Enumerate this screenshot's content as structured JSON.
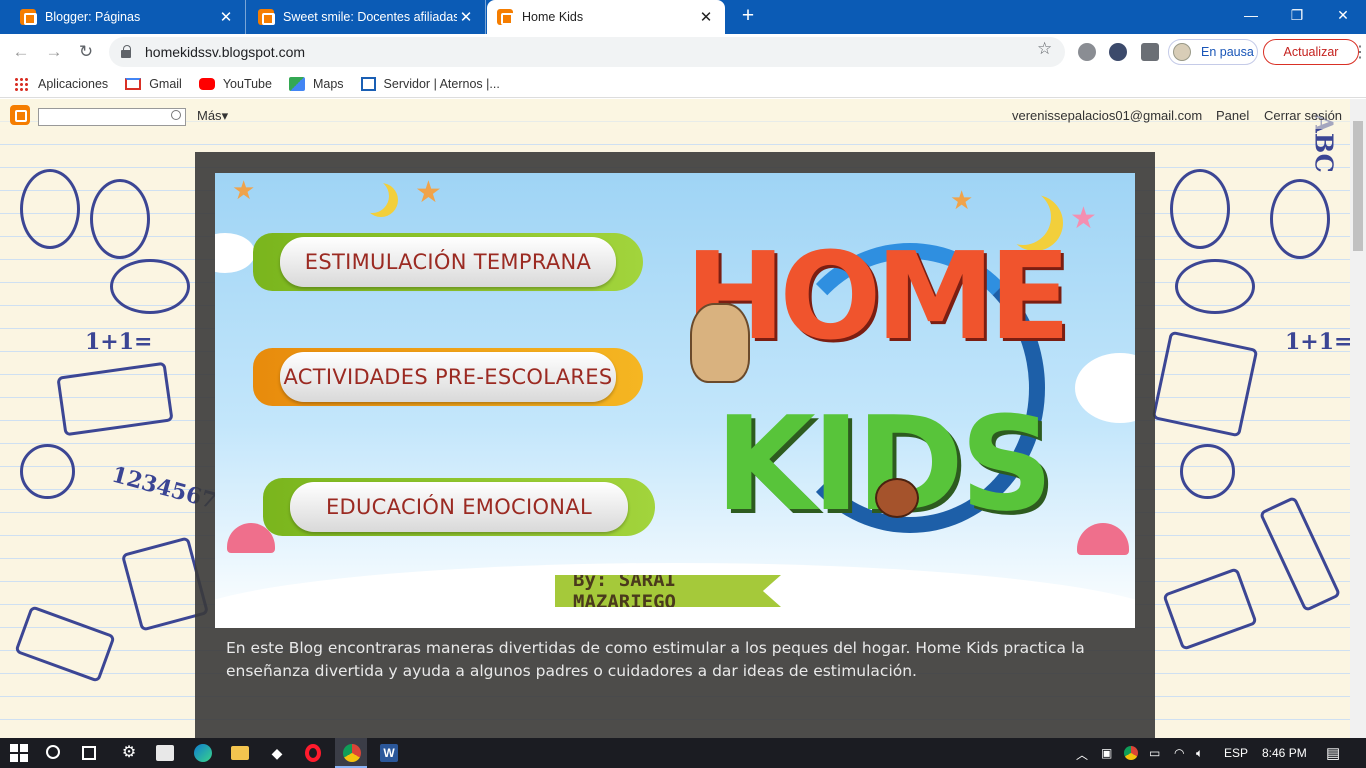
{
  "browser": {
    "tabs": [
      {
        "title": "Blogger: Páginas",
        "active": false
      },
      {
        "title": "Sweet smile: Docentes afiliadas",
        "active": false
      },
      {
        "title": "Home Kids",
        "active": true
      }
    ],
    "url": "homekidssv.blogspot.com",
    "profile_label": "En pausa",
    "update_label": "Actualizar",
    "bookmarks": [
      "Aplicaciones",
      "Gmail",
      "YouTube",
      "Maps",
      "Servidor | Aternos |..."
    ]
  },
  "blogger_navbar": {
    "more_label": "Más",
    "email": "verenissepalacios01@gmail.com",
    "panel_label": "Panel",
    "logout_label": "Cerrar sesión"
  },
  "banner": {
    "buttons": [
      "ESTIMULACIÓN TEMPRANA",
      "ACTIVIDADES PRE-ESCOLARES",
      "EDUCACIÓN EMOCIONAL"
    ],
    "logo_line1": "HOME",
    "logo_line2": "KIDS",
    "byline": "By: SARAI MAZARIEGO"
  },
  "description": "En este Blog encontraras maneras divertidas de como estimular a los peques del hogar. Home Kids practica la enseñanza divertida y ayuda a algunos padres o cuidadores a dar ideas de estimulación.",
  "taskbar": {
    "language": "ESP",
    "time": "8:46 PM"
  }
}
